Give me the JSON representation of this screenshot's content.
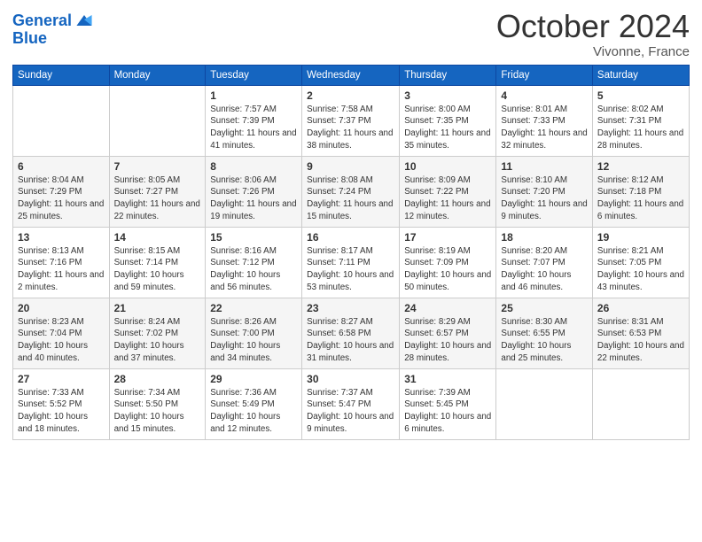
{
  "header": {
    "logo_line1": "General",
    "logo_line2": "Blue",
    "month": "October 2024",
    "location": "Vivonne, France"
  },
  "days_of_week": [
    "Sunday",
    "Monday",
    "Tuesday",
    "Wednesday",
    "Thursday",
    "Friday",
    "Saturday"
  ],
  "weeks": [
    [
      {
        "day": "",
        "info": ""
      },
      {
        "day": "",
        "info": ""
      },
      {
        "day": "1",
        "info": "Sunrise: 7:57 AM\nSunset: 7:39 PM\nDaylight: 11 hours and 41 minutes."
      },
      {
        "day": "2",
        "info": "Sunrise: 7:58 AM\nSunset: 7:37 PM\nDaylight: 11 hours and 38 minutes."
      },
      {
        "day": "3",
        "info": "Sunrise: 8:00 AM\nSunset: 7:35 PM\nDaylight: 11 hours and 35 minutes."
      },
      {
        "day": "4",
        "info": "Sunrise: 8:01 AM\nSunset: 7:33 PM\nDaylight: 11 hours and 32 minutes."
      },
      {
        "day": "5",
        "info": "Sunrise: 8:02 AM\nSunset: 7:31 PM\nDaylight: 11 hours and 28 minutes."
      }
    ],
    [
      {
        "day": "6",
        "info": "Sunrise: 8:04 AM\nSunset: 7:29 PM\nDaylight: 11 hours and 25 minutes."
      },
      {
        "day": "7",
        "info": "Sunrise: 8:05 AM\nSunset: 7:27 PM\nDaylight: 11 hours and 22 minutes."
      },
      {
        "day": "8",
        "info": "Sunrise: 8:06 AM\nSunset: 7:26 PM\nDaylight: 11 hours and 19 minutes."
      },
      {
        "day": "9",
        "info": "Sunrise: 8:08 AM\nSunset: 7:24 PM\nDaylight: 11 hours and 15 minutes."
      },
      {
        "day": "10",
        "info": "Sunrise: 8:09 AM\nSunset: 7:22 PM\nDaylight: 11 hours and 12 minutes."
      },
      {
        "day": "11",
        "info": "Sunrise: 8:10 AM\nSunset: 7:20 PM\nDaylight: 11 hours and 9 minutes."
      },
      {
        "day": "12",
        "info": "Sunrise: 8:12 AM\nSunset: 7:18 PM\nDaylight: 11 hours and 6 minutes."
      }
    ],
    [
      {
        "day": "13",
        "info": "Sunrise: 8:13 AM\nSunset: 7:16 PM\nDaylight: 11 hours and 2 minutes."
      },
      {
        "day": "14",
        "info": "Sunrise: 8:15 AM\nSunset: 7:14 PM\nDaylight: 10 hours and 59 minutes."
      },
      {
        "day": "15",
        "info": "Sunrise: 8:16 AM\nSunset: 7:12 PM\nDaylight: 10 hours and 56 minutes."
      },
      {
        "day": "16",
        "info": "Sunrise: 8:17 AM\nSunset: 7:11 PM\nDaylight: 10 hours and 53 minutes."
      },
      {
        "day": "17",
        "info": "Sunrise: 8:19 AM\nSunset: 7:09 PM\nDaylight: 10 hours and 50 minutes."
      },
      {
        "day": "18",
        "info": "Sunrise: 8:20 AM\nSunset: 7:07 PM\nDaylight: 10 hours and 46 minutes."
      },
      {
        "day": "19",
        "info": "Sunrise: 8:21 AM\nSunset: 7:05 PM\nDaylight: 10 hours and 43 minutes."
      }
    ],
    [
      {
        "day": "20",
        "info": "Sunrise: 8:23 AM\nSunset: 7:04 PM\nDaylight: 10 hours and 40 minutes."
      },
      {
        "day": "21",
        "info": "Sunrise: 8:24 AM\nSunset: 7:02 PM\nDaylight: 10 hours and 37 minutes."
      },
      {
        "day": "22",
        "info": "Sunrise: 8:26 AM\nSunset: 7:00 PM\nDaylight: 10 hours and 34 minutes."
      },
      {
        "day": "23",
        "info": "Sunrise: 8:27 AM\nSunset: 6:58 PM\nDaylight: 10 hours and 31 minutes."
      },
      {
        "day": "24",
        "info": "Sunrise: 8:29 AM\nSunset: 6:57 PM\nDaylight: 10 hours and 28 minutes."
      },
      {
        "day": "25",
        "info": "Sunrise: 8:30 AM\nSunset: 6:55 PM\nDaylight: 10 hours and 25 minutes."
      },
      {
        "day": "26",
        "info": "Sunrise: 8:31 AM\nSunset: 6:53 PM\nDaylight: 10 hours and 22 minutes."
      }
    ],
    [
      {
        "day": "27",
        "info": "Sunrise: 7:33 AM\nSunset: 5:52 PM\nDaylight: 10 hours and 18 minutes."
      },
      {
        "day": "28",
        "info": "Sunrise: 7:34 AM\nSunset: 5:50 PM\nDaylight: 10 hours and 15 minutes."
      },
      {
        "day": "29",
        "info": "Sunrise: 7:36 AM\nSunset: 5:49 PM\nDaylight: 10 hours and 12 minutes."
      },
      {
        "day": "30",
        "info": "Sunrise: 7:37 AM\nSunset: 5:47 PM\nDaylight: 10 hours and 9 minutes."
      },
      {
        "day": "31",
        "info": "Sunrise: 7:39 AM\nSunset: 5:45 PM\nDaylight: 10 hours and 6 minutes."
      },
      {
        "day": "",
        "info": ""
      },
      {
        "day": "",
        "info": ""
      }
    ]
  ]
}
